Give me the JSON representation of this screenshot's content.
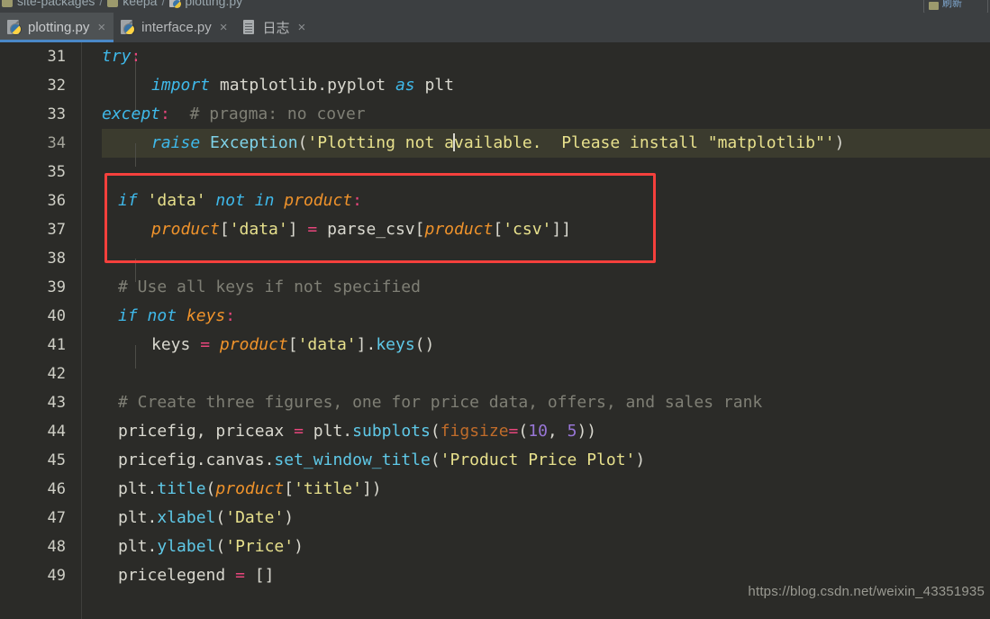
{
  "breadcrumb": {
    "items": [
      "site-packages",
      "keepa",
      "plotting.py"
    ],
    "separator": "/"
  },
  "top_right_chip": {
    "label": "刷新"
  },
  "tabs": [
    {
      "label": "plotting.py",
      "icon": "python-file-icon",
      "active": true,
      "close": "×"
    },
    {
      "label": "interface.py",
      "icon": "python-file-icon",
      "active": false,
      "close": "×"
    },
    {
      "label": "日志",
      "icon": "document-log-icon",
      "active": false,
      "close": "×"
    }
  ],
  "editor": {
    "current_line": 34,
    "gutter_numbers": [
      "31",
      "32",
      "33",
      "34",
      "35",
      "36",
      "37",
      "38",
      "39",
      "40",
      "41",
      "42",
      "43",
      "44",
      "45",
      "46",
      "47",
      "48",
      "49"
    ],
    "lines": {
      "l31": "try:",
      "l32": "import matplotlib.pyplot as plt",
      "l33": "except:  # pragma: no cover",
      "l34": "raise Exception('Plotting not available.  Please install \"matplotlib\"')",
      "l35": "",
      "l36": "if 'data' not in product:",
      "l37": "product['data'] = parse_csv[product['csv']]",
      "l38": "",
      "l39": "# Use all keys if not specified",
      "l40": "if not keys:",
      "l41": "keys = product['data'].keys()",
      "l42": "",
      "l43": "# Create three figures, one for price data, offers, and sales rank",
      "l44": "pricefig, priceax = plt.subplots(figsize=(10, 5))",
      "l45": "pricefig.canvas.set_window_title('Product Price Plot')",
      "l46": "plt.title(product['title'])",
      "l47": "plt.xlabel('Date')",
      "l48": "plt.ylabel('Price')",
      "l49": "pricelegend = []"
    },
    "tokens": {
      "try": "try",
      "import": "import",
      "as": "as",
      "except": "except",
      "raise": "raise",
      "if": "if",
      "not": "not",
      "in": "in",
      "colon": ":",
      "equals": "=",
      "matplotlib_pyplot": "matplotlib.pyplot",
      "plt": "plt",
      "pragma_comment": "# pragma: no cover",
      "Exception": "Exception",
      "exception_msg": "'Plotting not available.  Please install \"matplotlib\"'",
      "msg_part1": "'Plotting not a",
      "msg_part2": "vailable.  Please install \"matplotlib\"'",
      "data_str": "'data'",
      "product": "product",
      "csv_str": "'csv'",
      "parse_csv": "parse_csv",
      "use_keys_comment": "# Use all keys if not specified",
      "keys": "keys",
      "keys_call": "keys",
      "keys_parens": "()",
      "create_fig_comment": "# Create three figures, one for price data, offers, and sales rank",
      "pricefig": "pricefig",
      "priceax": "priceax",
      "subplots": "subplots",
      "figsize": "figsize",
      "num10": "10",
      "num5": "5",
      "canvas": "canvas",
      "set_window_title": "set_window_title",
      "product_price_plot": "'Product Price Plot'",
      "title_fn": "title",
      "title_str": "'title'",
      "xlabel": "xlabel",
      "date_str": "'Date'",
      "ylabel": "ylabel",
      "price_str": "'Price'",
      "pricelegend": "pricelegend",
      "empty_list": "[]"
    }
  },
  "annotation": {
    "type": "red-rectangle",
    "color": "#f5403c",
    "covers_lines": "36-37"
  },
  "watermark": {
    "text": "https://blog.csdn.net/weixin_43351935"
  },
  "colors": {
    "editor_bg": "#2b2b28",
    "chrome_bg": "#3c3f41",
    "active_tab_bg": "#4e5254",
    "active_tab_underline": "#4a88c7",
    "current_line_bg": "#3b3b2e",
    "annotation_red": "#f5403c",
    "keyword": "#3fb9ea",
    "string": "#e7e08c",
    "comment": "#7f7f75",
    "variable": "#f0932b",
    "function": "#5fc9e8",
    "operator": "#e8467c",
    "number": "#9876d6"
  }
}
